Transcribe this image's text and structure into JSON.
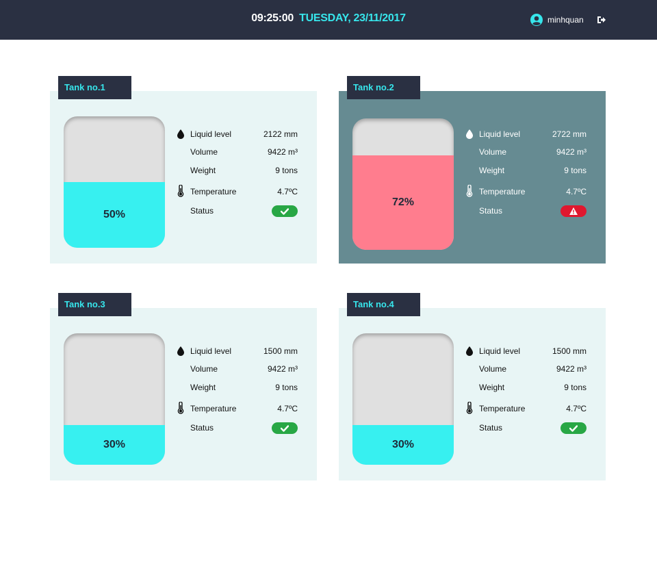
{
  "header": {
    "time": "09:25:00",
    "date": "TUESDAY, 23/11/2017",
    "username": "minhquan",
    "avatar_icon": "user-circle-icon",
    "logout_icon": "sign-out-icon",
    "accent_color": "#37e6ec",
    "bar_color": "#2a3042"
  },
  "labels": {
    "liquid_level": "Liquid level",
    "volume": "Volume",
    "weight": "Weight",
    "temperature": "Temperature",
    "status": "Status"
  },
  "tanks": [
    {
      "name": "Tank no.1",
      "fill_percent": 50,
      "fill_text": "50%",
      "liquid_level": "2122 mm",
      "volume": "9422 m³",
      "weight": "9 tons",
      "temperature": "4.7ºC",
      "status": "ok",
      "status_icon": "check-icon"
    },
    {
      "name": "Tank no.2",
      "fill_percent": 72,
      "fill_text": "72%",
      "liquid_level": "2722 mm",
      "volume": "9422 m³",
      "weight": "9 tons",
      "temperature": "4.7ºC",
      "status": "warning",
      "status_icon": "warning-triangle-icon"
    },
    {
      "name": "Tank no.3",
      "fill_percent": 30,
      "fill_text": "30%",
      "liquid_level": "1500 mm",
      "volume": "9422 m³",
      "weight": "9 tons",
      "temperature": "4.7ºC",
      "status": "ok",
      "status_icon": "check-icon"
    },
    {
      "name": "Tank no.4",
      "fill_percent": 30,
      "fill_text": "30%",
      "liquid_level": "1500 mm",
      "volume": "9422 m³",
      "weight": "9 tons",
      "temperature": "4.7ºC",
      "status": "ok",
      "status_icon": "check-icon"
    }
  ],
  "colors": {
    "normal_fill": "#37f0f0",
    "danger_fill": "#ff7d8e",
    "ok_badge": "#28a745",
    "warn_badge": "#e0182f"
  }
}
